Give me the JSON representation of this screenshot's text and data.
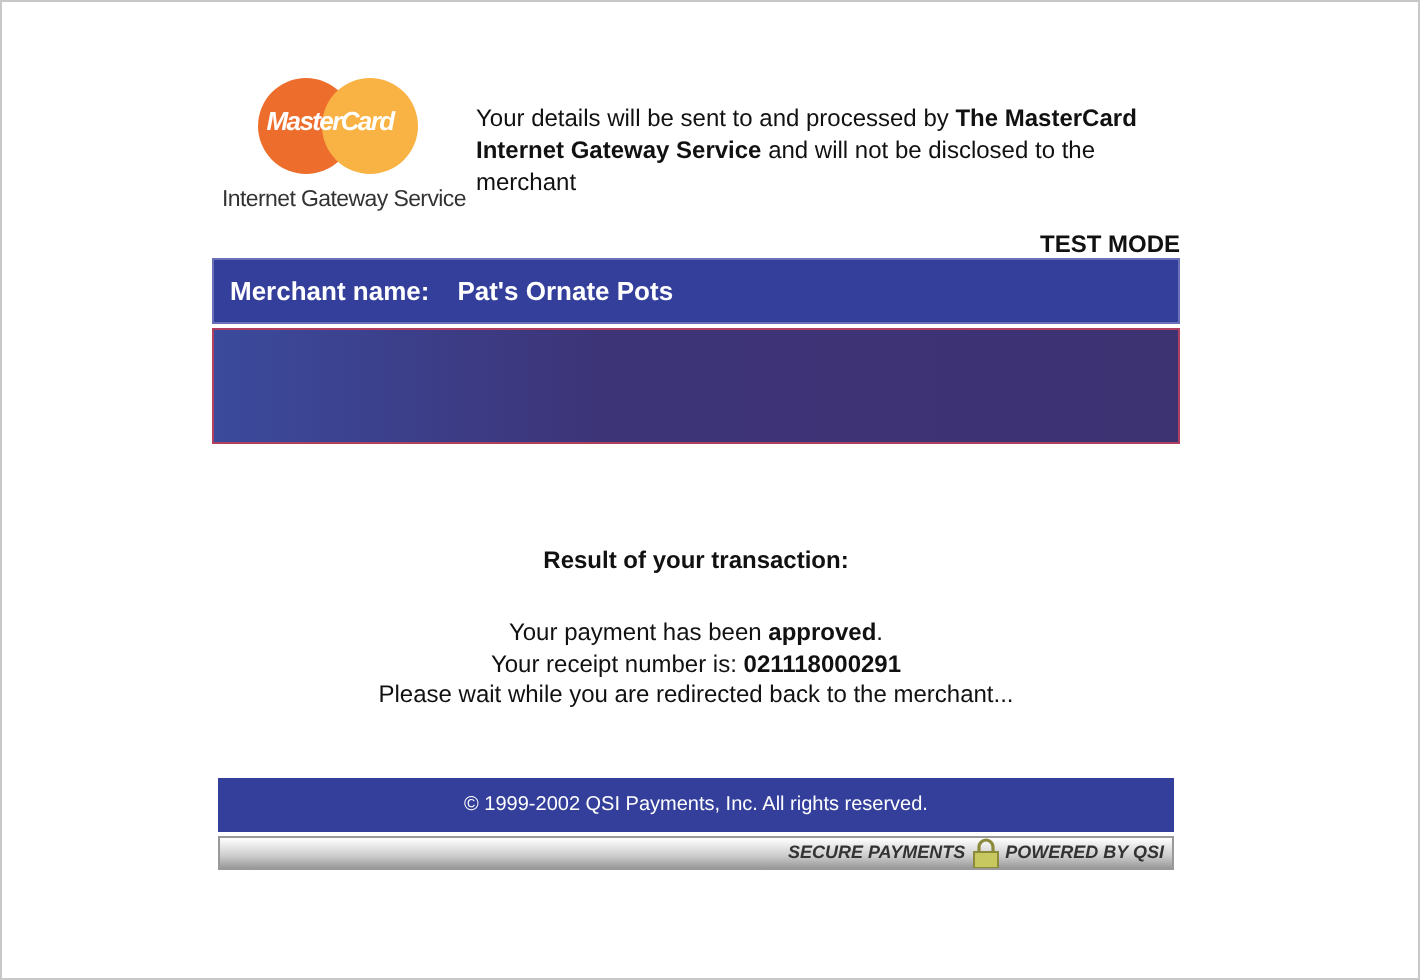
{
  "logo": {
    "wordmark": "MasterCard",
    "caption": "Internet Gateway Service"
  },
  "notice": "Your details will be sent to and processed by **The MasterCard Internet Gateway Service** and will not be disclosed to the merchant",
  "mode_label": "TEST MODE",
  "merchant": {
    "label": "Merchant name:",
    "name": "Pat's Ornate Pots"
  },
  "result": {
    "heading": "Result of your transaction:",
    "lines": [
      "Your payment has been **approved**.",
      "Your receipt number is: **021118000291**",
      "Please wait while you are redirected back to the merchant..."
    ]
  },
  "footer": {
    "copyright": "© 1999-2002 QSI Payments, Inc. All rights reserved.",
    "secure_label": "SECURE PAYMENTS",
    "powered_label": "POWERED BY QSI"
  }
}
